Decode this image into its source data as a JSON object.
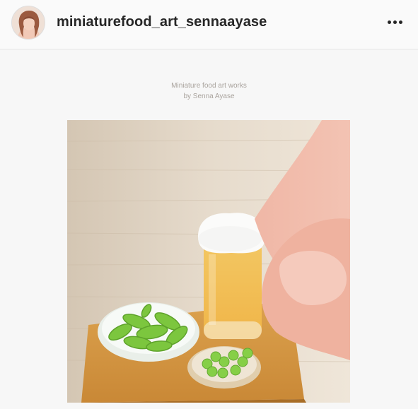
{
  "post": {
    "username": "miniaturefood_art_sennaayase",
    "caption_line1": "Miniature food art works",
    "caption_line2": "by Senna Ayase"
  },
  "icons": {
    "avatar": "profile-photo",
    "more": "more-options-icon"
  },
  "colors": {
    "header_bg": "#fafafa",
    "text": "#262626",
    "caption": "#a9a39d"
  }
}
